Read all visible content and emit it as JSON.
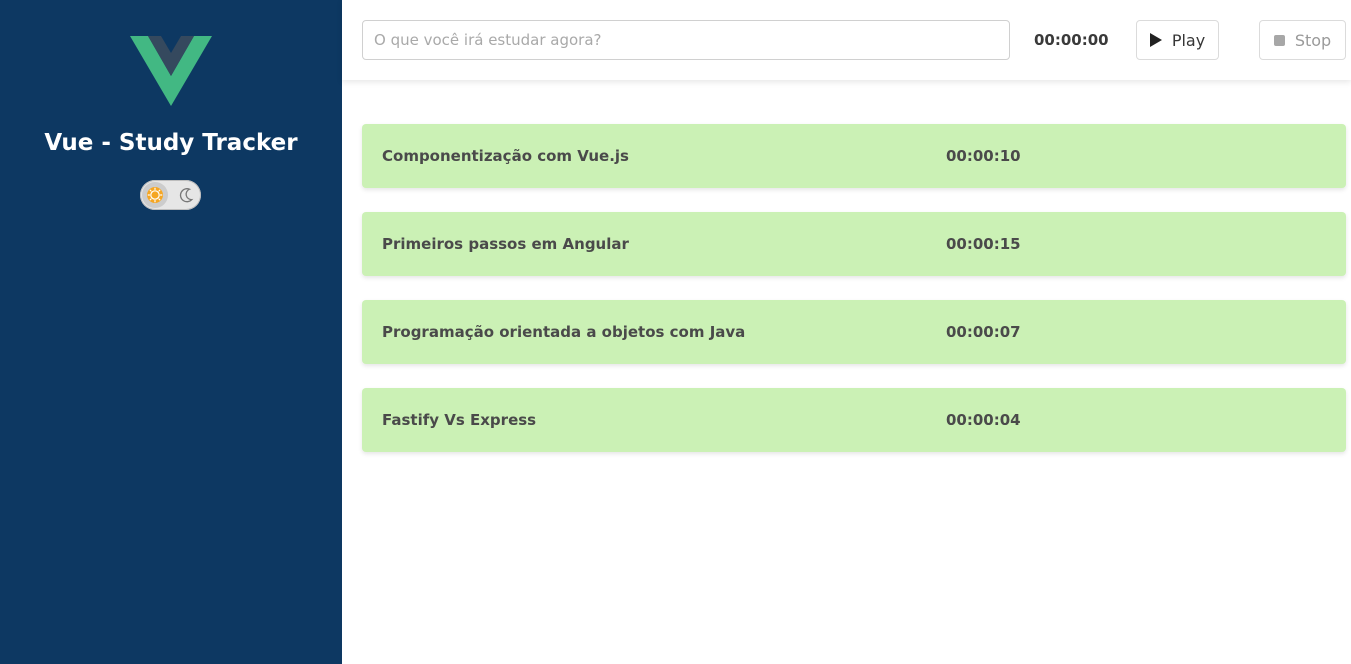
{
  "sidebar": {
    "logo_icon": "vue-logo-icon",
    "title": "Vue - Study Tracker",
    "theme_toggle": {
      "light_icon": "sun-icon",
      "dark_icon": "moon-icon",
      "state": "light"
    }
  },
  "topbar": {
    "task_input": {
      "value": "",
      "placeholder": "O que você irá estudar agora?"
    },
    "timer": "00:00:00",
    "play_label": "Play",
    "stop_label": "Stop"
  },
  "tasks": [
    {
      "name": "Componentização com Vue.js",
      "duration": "00:00:10"
    },
    {
      "name": "Primeiros passos em Angular",
      "duration": "00:00:15"
    },
    {
      "name": "Programação orientada a objetos com Java",
      "duration": "00:00:07"
    },
    {
      "name": "Fastify Vs Express",
      "duration": "00:00:04"
    }
  ],
  "colors": {
    "sidebar_bg": "#0d3862",
    "task_bg": "#cbf1b5",
    "vue_green": "#42b883",
    "vue_dark": "#35495e"
  }
}
